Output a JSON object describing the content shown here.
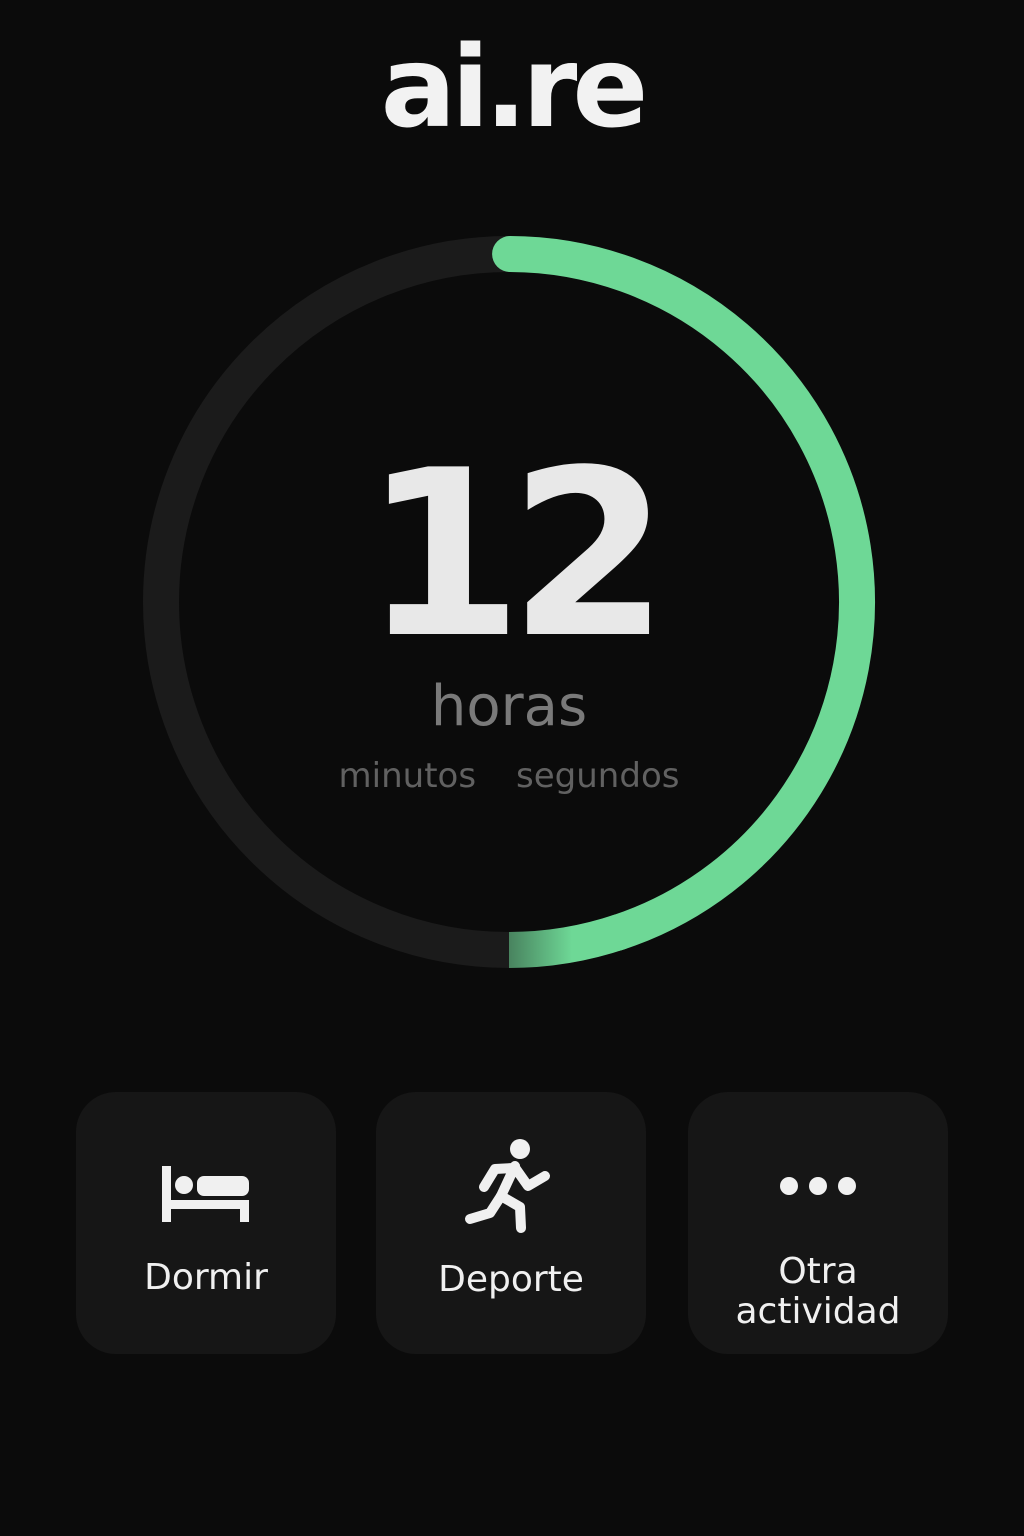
{
  "app": {
    "title": "ai.re"
  },
  "timer": {
    "value": "12",
    "unit_main": "horas",
    "unit_minutes": "minutos",
    "unit_seconds": "segundos",
    "progress_fraction": 0.5,
    "ring_track_color": "#1b1b1b",
    "ring_progress_color": "#6ed896"
  },
  "activities": [
    {
      "label": "Dormir",
      "icon": "bed-icon"
    },
    {
      "label": "Deporte",
      "icon": "running-person-icon"
    },
    {
      "label": "Otra actividad",
      "icon": "more-dots-icon"
    }
  ]
}
